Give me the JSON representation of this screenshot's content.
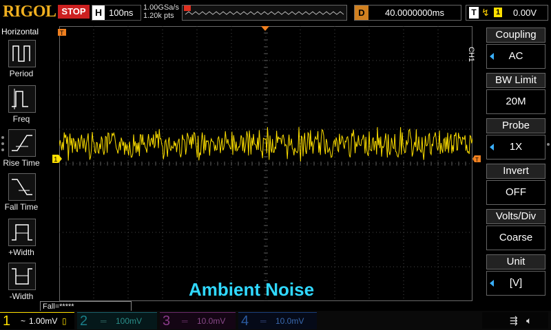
{
  "topbar": {
    "brand": "RIGOL",
    "run_state": "STOP",
    "horizontal_label": "H",
    "timebase": "100ns",
    "sample_rate": "1.00GSa/s",
    "mem_depth": "1.20k pts",
    "delay_label": "D",
    "delay_value": "40.0000000ms",
    "trigger_label": "T",
    "trigger_channel": "1",
    "trigger_level": "0.00V"
  },
  "left_menu": {
    "title": "Horizontal",
    "items": [
      {
        "label": "Period",
        "icon": "period-icon"
      },
      {
        "label": "Freq",
        "icon": "freq-icon"
      },
      {
        "label": "Rise Time",
        "icon": "rise-time-icon"
      },
      {
        "label": "Fall Time",
        "icon": "fall-time-icon"
      },
      {
        "label": "+Width",
        "icon": "pos-width-icon"
      },
      {
        "label": "-Width",
        "icon": "neg-width-icon"
      }
    ]
  },
  "right_menu": {
    "channel_tag": "CH1",
    "items": [
      {
        "title": "Coupling",
        "value": "AC"
      },
      {
        "title": "BW Limit",
        "value": "20M"
      },
      {
        "title": "Probe",
        "value": "1X"
      },
      {
        "title": "Invert",
        "value": "OFF"
      },
      {
        "title": "Volts/Div",
        "value": "Coarse"
      },
      {
        "title": "Unit",
        "value": "[V]"
      }
    ]
  },
  "screen": {
    "caption": "Ambient Noise",
    "ch1_marker": "1",
    "trigger_marker": "T",
    "measure_readout": "Fall=*****"
  },
  "channels": [
    {
      "num": "1",
      "scale": "1.00mV",
      "coupling_icon": "~",
      "color": "#ffe000"
    },
    {
      "num": "2",
      "scale": "100mV",
      "color": "#1a5f6a"
    },
    {
      "num": "3",
      "scale": "10.0mV",
      "color": "#6a2a6a"
    },
    {
      "num": "4",
      "scale": "10.0mV",
      "color": "#1a3f7a"
    }
  ],
  "colors": {
    "ch1": "#ffe000",
    "accent_blue": "#3ab0ff",
    "caption": "#30d8ff",
    "marker_orange": "#f08020"
  },
  "waveform": {
    "channel": "1",
    "description_level": 0.43
  }
}
